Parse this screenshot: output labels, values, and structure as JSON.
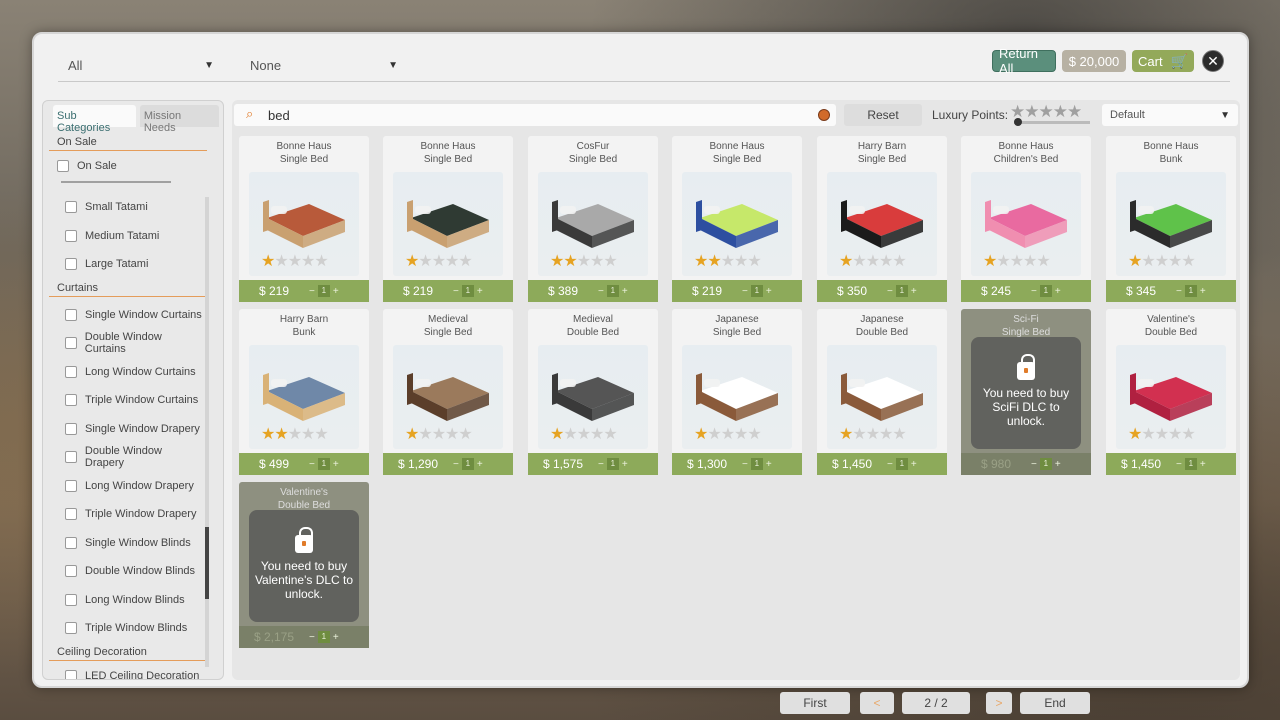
{
  "topbar": {
    "filter1": "All",
    "filter2": "None",
    "return_all": "Return All",
    "money": "$ 20,000",
    "cart": "Cart"
  },
  "sidebar": {
    "tabs": [
      "Sub Categories",
      "Mission Needs"
    ],
    "on_sale_header": "On Sale",
    "on_sale_item": "On Sale",
    "items": [
      {
        "label": "Small Tatami"
      },
      {
        "label": "Medium Tatami"
      },
      {
        "label": "Large Tatami"
      }
    ],
    "curtains_header": "Curtains",
    "curtains": [
      "Single Window Curtains",
      "Double Window Curtains",
      "Long Window Curtains",
      "Triple Window Curtains",
      "Single Window Drapery",
      "Double Window Drapery",
      "Long Window Drapery",
      "Triple Window Drapery",
      "Single Window Blinds",
      "Double Window Blinds",
      "Long Window Blinds",
      "Triple Window Blinds"
    ],
    "ceiling_header": "Ceiling Decoration",
    "ceiling_item": "LED Ceiling Decoration"
  },
  "search": {
    "value": "bed",
    "reset": "Reset",
    "luxury_label": "Luxury Points:",
    "sort": "Default"
  },
  "products": [
    {
      "brand": "Bonne Haus",
      "name": "Single Bed",
      "price": "$ 219",
      "stars": 1,
      "locked": false,
      "color": "#c9a070",
      "bedding": "#b85a3a"
    },
    {
      "brand": "Bonne Haus",
      "name": "Single Bed",
      "price": "$ 219",
      "stars": 1,
      "locked": false,
      "color": "#c9a070",
      "bedding": "#2f3a33"
    },
    {
      "brand": "CosFur",
      "name": "Single Bed",
      "price": "$ 389",
      "stars": 2,
      "locked": false,
      "color": "#3a3a3a",
      "bedding": "#a9a9a9"
    },
    {
      "brand": "Bonne Haus",
      "name": "Single Bed",
      "price": "$ 219",
      "stars": 2,
      "locked": false,
      "color": "#2d4fa0",
      "bedding": "#c6e86a"
    },
    {
      "brand": "Harry Barn",
      "name": "Single Bed",
      "price": "$ 350",
      "stars": 1,
      "locked": false,
      "color": "#1b1b1b",
      "bedding": "#d93c3c"
    },
    {
      "brand": "Bonne Haus",
      "name": "Children's Bed",
      "price": "$ 245",
      "stars": 1,
      "locked": false,
      "color": "#f08eb0",
      "bedding": "#e96aa0"
    },
    {
      "brand": "Bonne Haus",
      "name": "Bunk",
      "price": "$ 345",
      "stars": 1,
      "locked": false,
      "color": "#2b2b2b",
      "bedding": "#5fc24a"
    },
    {
      "brand": "Harry Barn",
      "name": "Bunk",
      "price": "$ 499",
      "stars": 2,
      "locked": false,
      "color": "#d9b277",
      "bedding": "#6f88a8"
    },
    {
      "brand": "Medieval",
      "name": "Single Bed",
      "price": "$ 1,290",
      "stars": 1,
      "locked": false,
      "color": "#5b3e2a",
      "bedding": "#9b7a5c"
    },
    {
      "brand": "Medieval",
      "name": "Double Bed",
      "price": "$ 1,575",
      "stars": 1,
      "locked": false,
      "color": "#3a3a3a",
      "bedding": "#555555"
    },
    {
      "brand": "Japanese",
      "name": "Single Bed",
      "price": "$ 1,300",
      "stars": 1,
      "locked": false,
      "color": "#8a5a3a",
      "bedding": "#ffffff"
    },
    {
      "brand": "Japanese",
      "name": "Double Bed",
      "price": "$ 1,450",
      "stars": 1,
      "locked": false,
      "color": "#8a5a3a",
      "bedding": "#ffffff"
    },
    {
      "brand": "Sci-Fi",
      "name": "Single Bed",
      "price": "$ 980",
      "stars": 0,
      "locked": true,
      "lock_text": "You need to buy SciFi DLC to unlock."
    },
    {
      "brand": "Valentine's",
      "name": "Double Bed",
      "price": "$ 1,450",
      "stars": 1,
      "locked": false,
      "color": "#b02040",
      "bedding": "#d23050"
    },
    {
      "brand": "Valentine's",
      "name": "Double Bed",
      "price": "$ 2,175",
      "stars": 0,
      "locked": true,
      "lock_text": "You need to buy Valentine's DLC to unlock."
    }
  ],
  "pager": {
    "first": "First",
    "prev": "<",
    "page": "2 / 2",
    "next": ">",
    "end": "End"
  },
  "colors": {
    "accent_green": "#8daa5a",
    "return_teal": "#5b8f7c",
    "star_gold": "#e6a322",
    "orange": "#e07b2a"
  }
}
